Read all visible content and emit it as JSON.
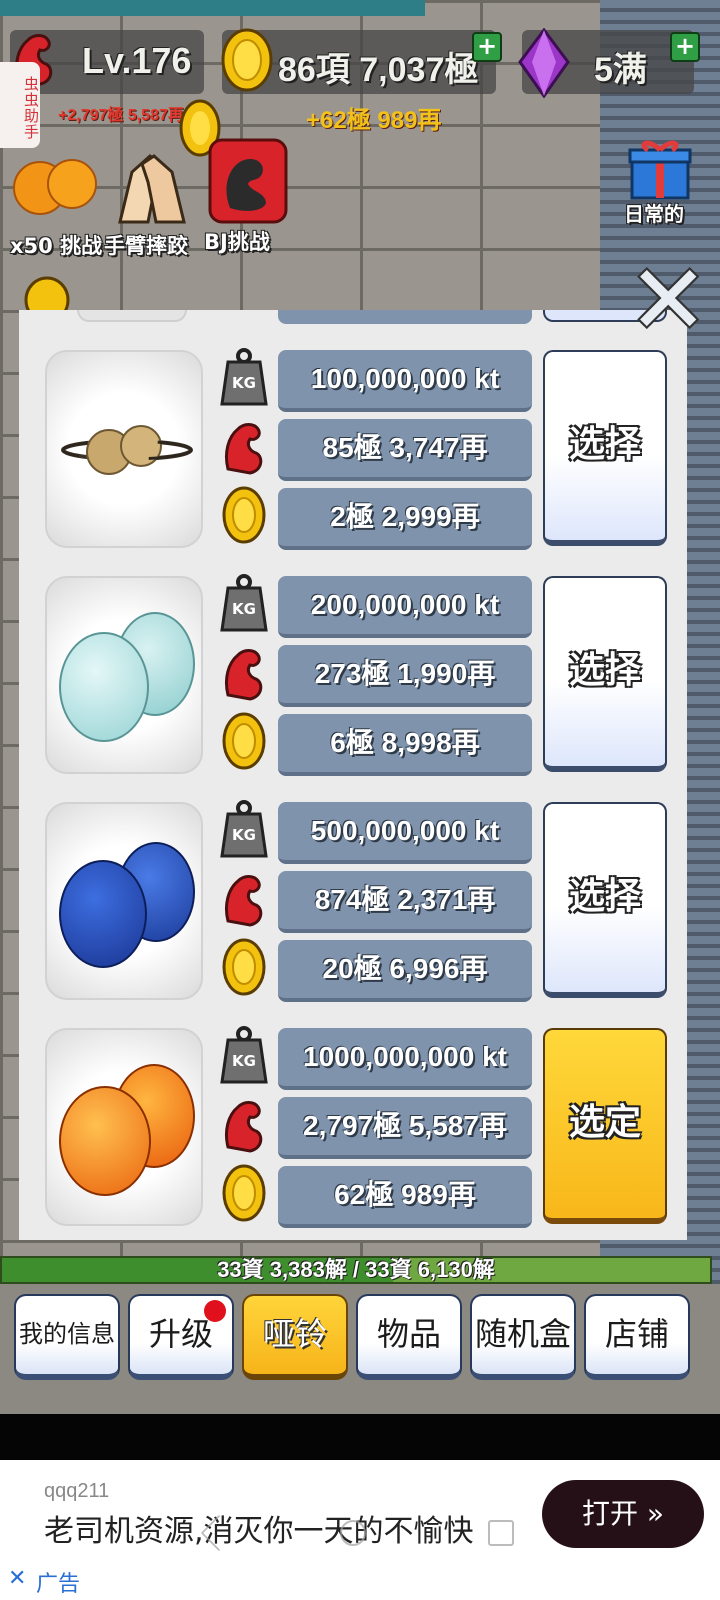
{
  "hud": {
    "level": "Lv.176",
    "level_sub": "+2,797極 5,587再",
    "gold": "86項 7,037極",
    "gold_sub": "+62極 989再",
    "gems": "5满",
    "plus_label": "+"
  },
  "side_tab": {
    "label": "虫虫助手"
  },
  "quick_actions": [
    {
      "icon": "sun-dumbbell-icon",
      "label": "x50 挑战"
    },
    {
      "icon": "arm-wrestling-icon",
      "label": "手臂摔跤"
    },
    {
      "icon": "bj-challenge-icon",
      "label": "BJ挑战"
    }
  ],
  "daily": {
    "icon": "gift-icon",
    "label": "日常的"
  },
  "modal": {
    "close_label": "✕",
    "items": [
      {
        "planet": "saturn",
        "weight": "100,000,000 kt",
        "strength": "85極 3,747再",
        "cost": "2極 2,999再",
        "button": "选择",
        "active": false
      },
      {
        "planet": "uranus",
        "weight": "200,000,000 kt",
        "strength": "273極 1,990再",
        "cost": "6極 8,998再",
        "button": "选择",
        "active": false
      },
      {
        "planet": "neptune",
        "weight": "500,000,000 kt",
        "strength": "874極 2,371再",
        "cost": "20極 6,996再",
        "button": "选择",
        "active": false
      },
      {
        "planet": "sun",
        "weight": "1000,000,000 kt",
        "strength": "2,797極 5,587再",
        "cost": "62極 989再",
        "button": "选定",
        "active": true
      }
    ],
    "stat_icons": {
      "weight": "kg-weight-icon",
      "strength": "flexed-arm-icon",
      "cost": "gold-coin-icon"
    },
    "kg_label": "KG"
  },
  "progress": {
    "text": "33資 3,383解 / 33資 6,130解",
    "fraction": 0.5519
  },
  "menu": [
    {
      "label": "我的信息",
      "active": false,
      "badge": false
    },
    {
      "label": "升级",
      "active": false,
      "badge": true
    },
    {
      "label": "哑铃",
      "active": true,
      "badge": false
    },
    {
      "label": "物品",
      "active": false,
      "badge": false
    },
    {
      "label": "随机盒",
      "active": false,
      "badge": false
    },
    {
      "label": "店铺",
      "active": false,
      "badge": false
    }
  ],
  "ad": {
    "sub": "qqq211",
    "main": "老司机资源,消灭你一天的不愉快",
    "button": "打开 »",
    "close": "✕",
    "tag": "广告"
  },
  "colors": {
    "stat_box": "#7f93ad",
    "active_button": "#f8b71a",
    "progress_green": "#6fa840"
  }
}
